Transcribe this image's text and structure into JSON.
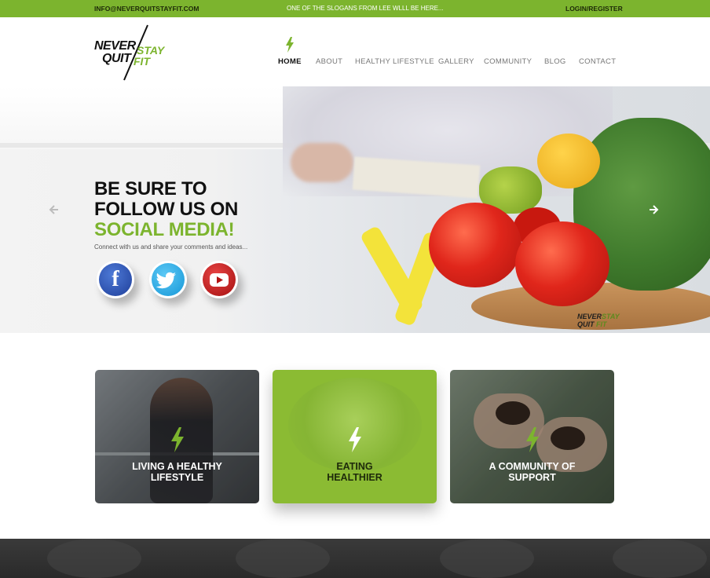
{
  "topbar": {
    "email": "INFO@NEVERQUITSTAYFIT.COM",
    "slogan": "ONE OF THE SLOGANS FROM LEE WLLL BE HERE...",
    "login": "LOGIN/REGISTER"
  },
  "logo": {
    "word1": "NEVER",
    "word2": "QUIT",
    "word3": "STAY",
    "word4": "FIT"
  },
  "nav": {
    "items": [
      {
        "label": "HOME",
        "active": true
      },
      {
        "label": "ABOUT"
      },
      {
        "label": "HEALTHY LIFESTYLE"
      },
      {
        "label": "GALLERY"
      },
      {
        "label": "COMMUNITY"
      },
      {
        "label": "BLOG"
      },
      {
        "label": "CONTACT"
      }
    ]
  },
  "hero": {
    "line1": "BE SURE TO",
    "line2": "FOLLOW US ON",
    "line3": "SOCIAL MEDIA!",
    "subtitle": "Connect with us and share your comments and ideas...",
    "social": [
      {
        "icon": "facebook-icon",
        "glyph": "f"
      },
      {
        "icon": "twitter-icon"
      },
      {
        "icon": "youtube-icon"
      }
    ],
    "watermark_never": "NEVER",
    "watermark_quit": "QUIT",
    "watermark_stay": "STAY",
    "watermark_fit": "FIT",
    "prev_icon": "arrow-left-icon",
    "next_icon": "arrow-right-icon"
  },
  "cards": [
    {
      "title_line1": "LIVING A HEALTHY",
      "title_line2": "LIFESTYLE"
    },
    {
      "title_line1": "EATING",
      "title_line2": "HEALTHIER"
    },
    {
      "title_line1": "A COMMUNITY OF",
      "title_line2": "SUPPORT"
    }
  ],
  "colors": {
    "accent": "#7cb42e",
    "dark": "#111111",
    "card_green": "#8bbb33"
  }
}
